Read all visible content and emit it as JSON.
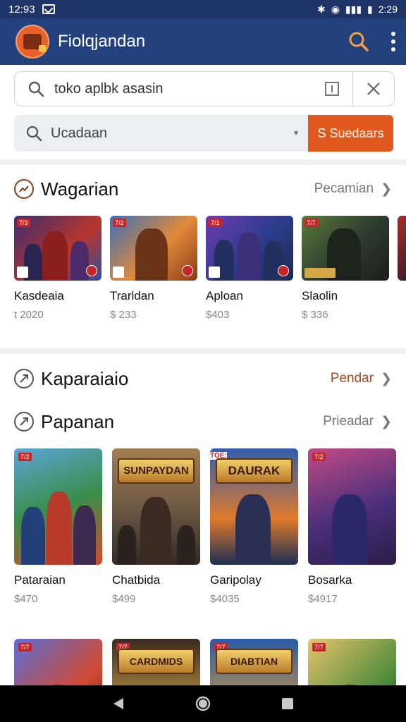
{
  "status": {
    "time": "12:93",
    "battery_text": "2:29"
  },
  "app": {
    "title": "Fiolqjandan"
  },
  "search": {
    "query": "toko aplbk asasin"
  },
  "filter": {
    "dropdown_label": "Ucadaan",
    "button_label": "S Suedaars"
  },
  "sections": [
    {
      "title": "Wagarian",
      "more_label": "Pecamian",
      "items": [
        {
          "name": "Kasdeaia",
          "price": "t 2020",
          "badge": "7/3",
          "colors": [
            "#3b2e6e",
            "#b8362c",
            "#2d4f9c"
          ]
        },
        {
          "name": "Trarldan",
          "price": "$ 233",
          "badge": "7/2",
          "colors": [
            "#e18a3a",
            "#8c3a18",
            "#3a6fb7"
          ]
        },
        {
          "name": "Aploan",
          "price": "$403",
          "badge": "7/1",
          "colors": [
            "#2a3c8a",
            "#6d3bb0",
            "#1b2a55"
          ]
        },
        {
          "name": "Slaolin",
          "price": "$ 336",
          "badge": "7/7",
          "colors": [
            "#2c3a2e",
            "#5b7a3b",
            "#1a1f1a"
          ]
        }
      ]
    },
    {
      "title": "Kaparaiaio",
      "more_label": "Pendar"
    },
    {
      "title": "Papanan",
      "more_label": "Prieadar",
      "items": [
        {
          "name": "Pataraian",
          "price": "$470",
          "badge": "7/2",
          "colors": [
            "#5aa6d8",
            "#3a8d4a",
            "#d44a2a"
          ]
        },
        {
          "name": "Chatbida",
          "price": "$499",
          "badge": "",
          "colors": [
            "#6e5a44",
            "#2f2a26",
            "#a37d50"
          ]
        },
        {
          "name": "Garipolay",
          "price": "$4035",
          "badge": "",
          "colors": [
            "#2f5fae",
            "#e07a2a",
            "#1c2e55"
          ]
        },
        {
          "name": "Bosarka",
          "price": "$4917",
          "badge": "7/2",
          "colors": [
            "#4b2f7a",
            "#c24a86",
            "#2a1c48"
          ]
        }
      ]
    },
    {
      "items": [
        {
          "badge": "7/7",
          "colors": [
            "#d24a32",
            "#5a6ed8",
            "#222"
          ]
        },
        {
          "badge": "7/7",
          "colors": [
            "#3a2a20",
            "#d6a84a",
            "#222"
          ]
        },
        {
          "badge": "7/7",
          "colors": [
            "#2a5aa8",
            "#e0a03a",
            "#222"
          ]
        },
        {
          "badge": "7/7",
          "colors": [
            "#e8c46a",
            "#4a8a3a",
            "#222"
          ]
        }
      ]
    }
  ],
  "posters": {
    "p2": "SUNPAYDAN",
    "p3": "DAURAK",
    "p3_tag": "TOE:",
    "r4_1": "CARDMIDS",
    "r4_2": "DIABTIAN"
  }
}
